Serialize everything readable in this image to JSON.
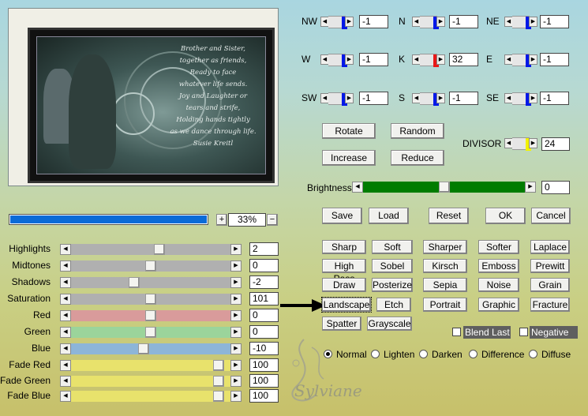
{
  "preview": {
    "poem_lines": [
      "Brother and Sister,",
      "together as friends,",
      "Ready to face",
      "whatever life sends.",
      "Joy and Laughter or",
      "tears and strife,",
      "Holding hands tightly",
      "as we dance through life.",
      "Susie Kreitl"
    ]
  },
  "zoom": {
    "progress_fraction": 1.0,
    "value": "33%",
    "plus": "+",
    "minus": "−"
  },
  "adjustments": [
    {
      "label": "Highlights",
      "value": "2",
      "track": "#b0b0b0",
      "thumb_fraction": 0.56
    },
    {
      "label": "Midtones",
      "value": "0",
      "track": "#b0b0b0",
      "thumb_fraction": 0.5
    },
    {
      "label": "Shadows",
      "value": "-2",
      "track": "#b0b0b0",
      "thumb_fraction": 0.39
    },
    {
      "label": "Saturation",
      "value": "101",
      "track": "#b0b0b0",
      "thumb_fraction": 0.5
    },
    {
      "label": "Red",
      "value": "0",
      "track": "#d99b9b",
      "thumb_fraction": 0.5
    },
    {
      "label": "Green",
      "value": "0",
      "track": "#9bd49b",
      "thumb_fraction": 0.5
    },
    {
      "label": "Blue",
      "value": "-10",
      "track": "#8db5d8",
      "thumb_fraction": 0.45
    },
    {
      "label": "Fade Red",
      "value": "100",
      "track": "#e8e26c",
      "thumb_fraction": 0.96
    },
    {
      "label": "Fade Green",
      "value": "100",
      "track": "#e8e26c",
      "thumb_fraction": 0.96
    },
    {
      "label": "Fade Blue",
      "value": "100",
      "track": "#e8e26c",
      "thumb_fraction": 0.96
    }
  ],
  "matrix": [
    {
      "label": "NW",
      "value": "-1",
      "knob": "#0018e8"
    },
    {
      "label": "N",
      "value": "-1",
      "knob": "#0018e8"
    },
    {
      "label": "NE",
      "value": "-1",
      "knob": "#0018e8"
    },
    {
      "label": "W",
      "value": "-1",
      "knob": "#0018e8"
    },
    {
      "label": "K",
      "value": "32",
      "knob": "#e81818"
    },
    {
      "label": "E",
      "value": "-1",
      "knob": "#0018e8"
    },
    {
      "label": "SW",
      "value": "-1",
      "knob": "#0018e8"
    },
    {
      "label": "S",
      "value": "-1",
      "knob": "#0018e8"
    },
    {
      "label": "SE",
      "value": "-1",
      "knob": "#0018e8"
    }
  ],
  "buttons": {
    "rotate": "Rotate",
    "random": "Random",
    "increase": "Increase",
    "reduce": "Reduce",
    "save": "Save",
    "load": "Load",
    "reset": "Reset",
    "ok": "OK",
    "cancel": "Cancel"
  },
  "divisor": {
    "label": "DIVISOR",
    "value": "24",
    "knob": "#f2f200"
  },
  "brightness": {
    "label": "Brightness",
    "value": "0",
    "fill": "#007c00",
    "thumb_fraction": 0.5
  },
  "presets": [
    "Sharp",
    "Soft",
    "Sharper",
    "Softer",
    "Laplace",
    "High Pass",
    "Sobel",
    "Kirsch",
    "Emboss",
    "Prewitt",
    "Draw",
    "Posterize",
    "Sepia",
    "Noise",
    "Grain",
    "Landscape",
    "Etch",
    "Portrait",
    "Graphic",
    "Fracture",
    "Spatter",
    "Grayscale"
  ],
  "options": {
    "blend_last": "Blend Last",
    "negative": "Negative"
  },
  "modes": {
    "selected": "Normal",
    "items": [
      "Normal",
      "Lighten",
      "Darken",
      "Difference",
      "Diffuse"
    ]
  },
  "watermark": "Sylviane"
}
